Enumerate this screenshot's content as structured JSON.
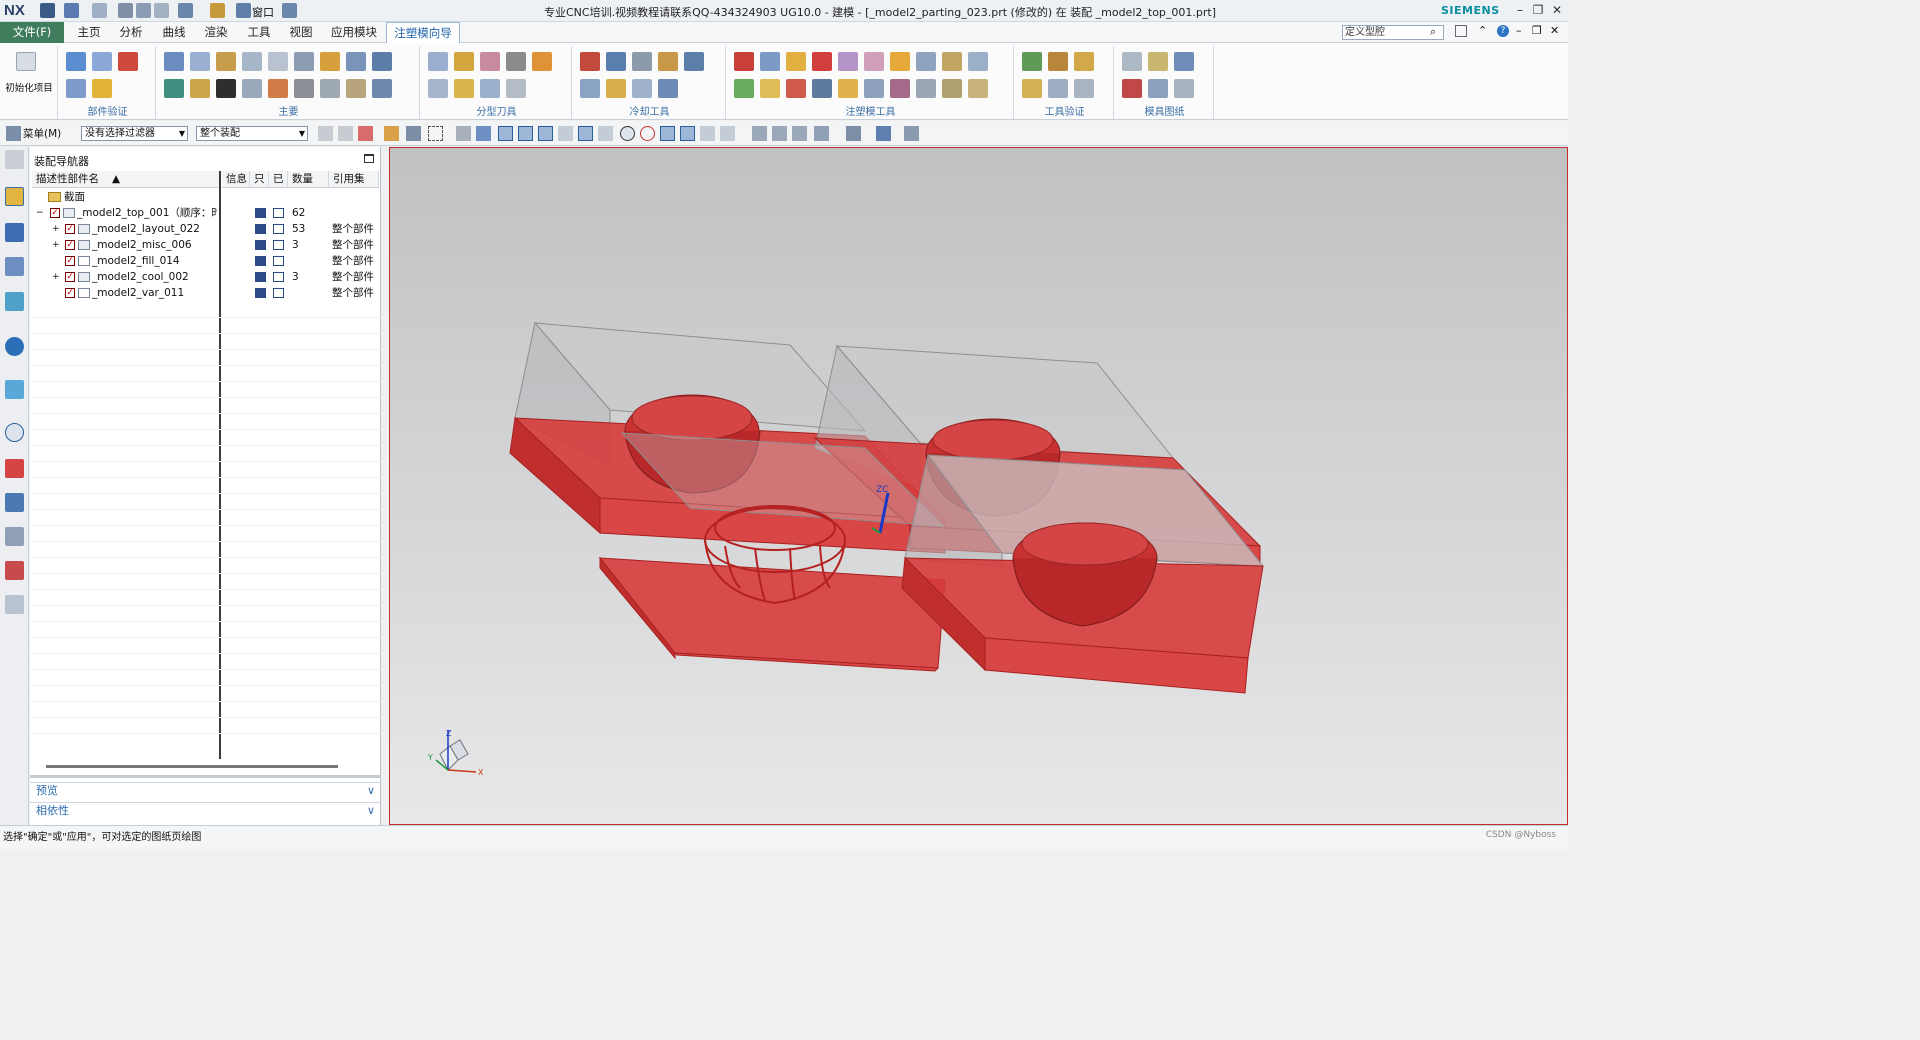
{
  "window": {
    "app_logo": "NX",
    "title": "专业CNC培训.视频教程请联系QQ-434324903 UG10.0 - 建模 - [_model2_parting_023.prt  (修改的)  在 装配 _model2_top_001.prt]",
    "brand": "SIEMENS",
    "quick_window_label": "窗口"
  },
  "menu": {
    "file_tab": "文件(F)",
    "items": [
      "主页",
      "分析",
      "曲线",
      "渲染",
      "工具",
      "视图",
      "应用模块",
      "注塑模向导"
    ],
    "active_index": 7,
    "search_placeholder": "定义型腔"
  },
  "ribbon": {
    "init_project_label": "初始化项目",
    "groups": [
      "部件验证",
      "主要",
      "分型刀具",
      "冷却工具",
      "注塑模工具",
      "工具验证",
      "模具图纸"
    ]
  },
  "toolbar2": {
    "menu_label": "菜单(M)",
    "filter_value": "没有选择过滤器",
    "scope_value": "整个装配"
  },
  "navigator": {
    "title": "装配导航器",
    "columns": [
      "描述性部件名",
      "信息",
      "只",
      "已",
      "数量",
      "引用集"
    ],
    "section_row": "截面",
    "rows": [
      {
        "name": "_model2_top_001（顺序：时...",
        "qty": "62",
        "refset": "",
        "expander": "−"
      },
      {
        "name": "_model2_layout_022",
        "qty": "53",
        "refset": "整个部件",
        "expander": "+"
      },
      {
        "name": "_model2_misc_006",
        "qty": "3",
        "refset": "整个部件",
        "expander": "+"
      },
      {
        "name": "_model2_fill_014",
        "qty": "",
        "refset": "整个部件",
        "expander": ""
      },
      {
        "name": "_model2_cool_002",
        "qty": "3",
        "refset": "整个部件",
        "expander": "+"
      },
      {
        "name": "_model2_var_011",
        "qty": "",
        "refset": "整个部件",
        "expander": ""
      }
    ],
    "preview_label": "预览",
    "dependency_label": "相依性"
  },
  "status": {
    "message": "选择\"确定\"或\"应用\"，可对选定的图纸页绘图",
    "watermark": "CSDN @Nyboss"
  },
  "viewport": {
    "wcs_label": "ZC",
    "triad_labels": {
      "x": "X",
      "y": "Y",
      "z": "Z"
    }
  },
  "colors": {
    "file_tab": "#3f7d5c",
    "mold_red": "#d63b3b",
    "accent_blue": "#1f62a8"
  }
}
